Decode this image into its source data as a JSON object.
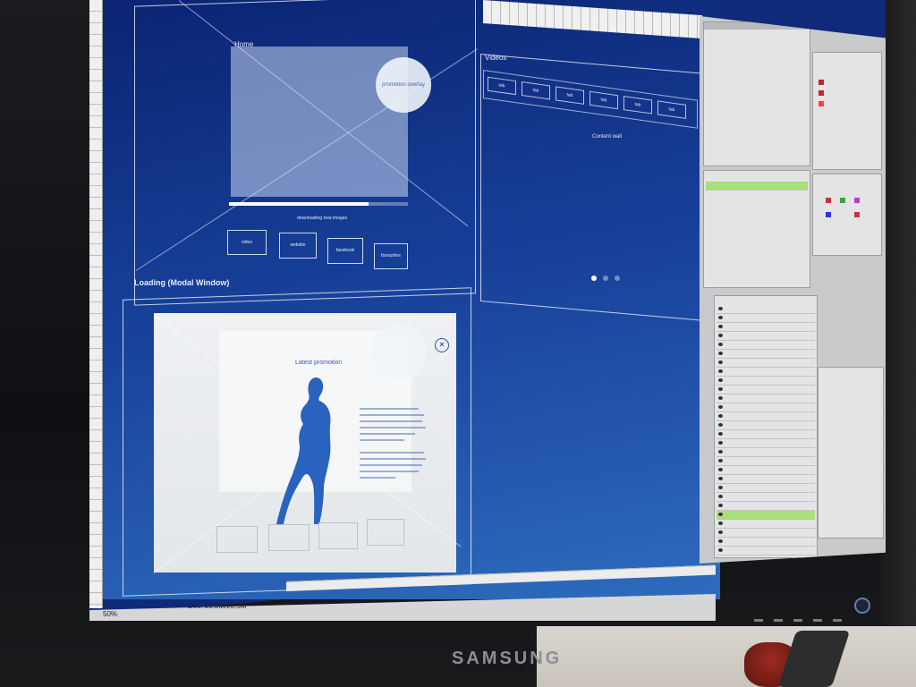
{
  "app": {
    "zoom_level": "50%",
    "doc_info": "Doc: 39.0M/20.5M"
  },
  "canvas": {
    "section_titles": [
      "Loading (Modal Window)"
    ],
    "artboards": [
      {
        "id": "top-left",
        "label": "Home",
        "promo_circle_text": "promotion overlay",
        "progress_fraction": 0.78,
        "progress_caption": "downloading new images",
        "buttons": [
          "video",
          "website",
          "facebook",
          "favourites"
        ]
      },
      {
        "id": "top-right",
        "label": "Videos",
        "tabs": [
          "tab",
          "tab",
          "tab",
          "tab",
          "tab",
          "tab"
        ],
        "content_text": "Content wall",
        "carousel_dots": 3,
        "carousel_active": 0
      },
      {
        "id": "bottom-left",
        "modal": {
          "title": "Latest promotion",
          "close_icon": "close-icon",
          "figure": "silhouette-figure",
          "buttons": [
            "",
            "",
            "",
            ""
          ]
        }
      }
    ]
  },
  "brand": {
    "name": "SAMSUNG"
  },
  "colors": {
    "canvas_blue": "#173f98",
    "accent_green": "#a8e07a",
    "close_blue": "#2d5aa5"
  }
}
